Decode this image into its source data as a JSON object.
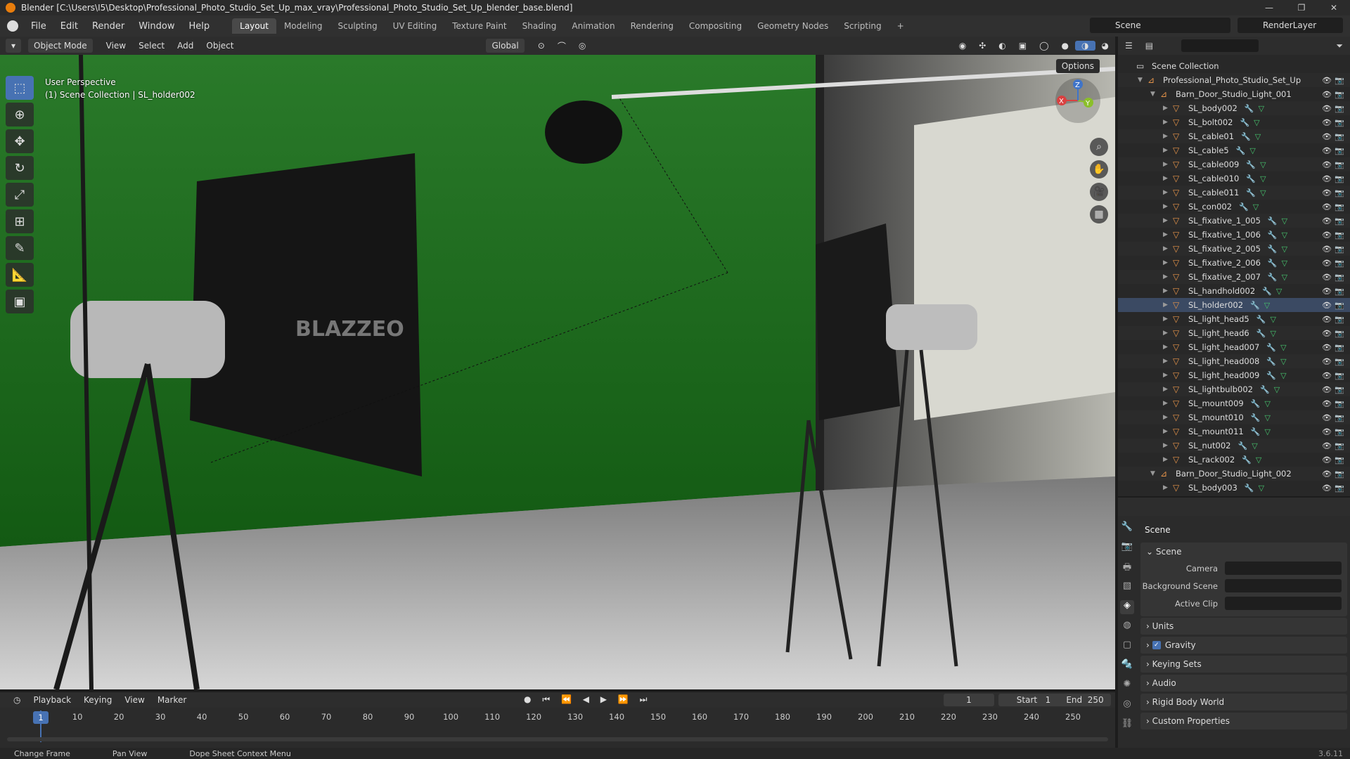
{
  "window": {
    "title": "Blender [C:\\Users\\I5\\Desktop\\Professional_Photo_Studio_Set_Up_max_vray\\Professional_Photo_Studio_Set_Up_blender_base.blend]",
    "controls": [
      "—",
      "❐",
      "✕"
    ]
  },
  "menu": [
    "File",
    "Edit",
    "Render",
    "Window",
    "Help"
  ],
  "workspaces": [
    "Layout",
    "Modeling",
    "Sculpting",
    "UV Editing",
    "Texture Paint",
    "Shading",
    "Animation",
    "Rendering",
    "Compositing",
    "Geometry Nodes",
    "Scripting",
    "+"
  ],
  "active_workspace": "Layout",
  "scene_selector": "Scene",
  "render_layer": "RenderLayer",
  "viewport_header": {
    "mode": "Object Mode",
    "menus": [
      "View",
      "Select",
      "Add",
      "Object"
    ],
    "transform_orientation": "Global",
    "options": "Options"
  },
  "viewport": {
    "perspective": "User Perspective",
    "context": "(1) Scene Collection | SL_holder002",
    "gizmo_axes": [
      "X",
      "Y",
      "Z"
    ]
  },
  "outliner": {
    "root": "Scene Collection",
    "rows": [
      {
        "label": "Professional_Photo_Studio_Set_Up",
        "depth": 1,
        "type": "collection"
      },
      {
        "label": "Barn_Door_Studio_Light_001",
        "depth": 2,
        "type": "collection"
      },
      {
        "label": "SL_body002",
        "depth": 3,
        "type": "mesh"
      },
      {
        "label": "SL_bolt002",
        "depth": 3,
        "type": "mesh"
      },
      {
        "label": "SL_cable01",
        "depth": 3,
        "type": "mesh"
      },
      {
        "label": "SL_cable5",
        "depth": 3,
        "type": "mesh"
      },
      {
        "label": "SL_cable009",
        "depth": 3,
        "type": "mesh"
      },
      {
        "label": "SL_cable010",
        "depth": 3,
        "type": "mesh"
      },
      {
        "label": "SL_cable011",
        "depth": 3,
        "type": "mesh"
      },
      {
        "label": "SL_con002",
        "depth": 3,
        "type": "mesh"
      },
      {
        "label": "SL_fixative_1_005",
        "depth": 3,
        "type": "mesh"
      },
      {
        "label": "SL_fixative_1_006",
        "depth": 3,
        "type": "mesh"
      },
      {
        "label": "SL_fixative_2_005",
        "depth": 3,
        "type": "mesh"
      },
      {
        "label": "SL_fixative_2_006",
        "depth": 3,
        "type": "mesh"
      },
      {
        "label": "SL_fixative_2_007",
        "depth": 3,
        "type": "mesh"
      },
      {
        "label": "SL_handhold002",
        "depth": 3,
        "type": "mesh"
      },
      {
        "label": "SL_holder002",
        "depth": 3,
        "type": "mesh",
        "selected": true
      },
      {
        "label": "SL_light_head5",
        "depth": 3,
        "type": "mesh"
      },
      {
        "label": "SL_light_head6",
        "depth": 3,
        "type": "mesh"
      },
      {
        "label": "SL_light_head007",
        "depth": 3,
        "type": "mesh"
      },
      {
        "label": "SL_light_head008",
        "depth": 3,
        "type": "mesh"
      },
      {
        "label": "SL_light_head009",
        "depth": 3,
        "type": "mesh"
      },
      {
        "label": "SL_lightbulb002",
        "depth": 3,
        "type": "mesh"
      },
      {
        "label": "SL_mount009",
        "depth": 3,
        "type": "mesh"
      },
      {
        "label": "SL_mount010",
        "depth": 3,
        "type": "mesh"
      },
      {
        "label": "SL_mount011",
        "depth": 3,
        "type": "mesh"
      },
      {
        "label": "SL_nut002",
        "depth": 3,
        "type": "mesh"
      },
      {
        "label": "SL_rack002",
        "depth": 3,
        "type": "mesh"
      },
      {
        "label": "Barn_Door_Studio_Light_002",
        "depth": 2,
        "type": "collection"
      },
      {
        "label": "SL_body003",
        "depth": 3,
        "type": "mesh"
      }
    ]
  },
  "properties": {
    "title": "Scene",
    "panel": "Scene",
    "fields": [
      {
        "label": "Camera"
      },
      {
        "label": "Background Scene"
      },
      {
        "label": "Active Clip"
      }
    ],
    "subpanels": [
      "Units",
      "Gravity",
      "Keying Sets",
      "Audio",
      "Rigid Body World",
      "Custom Properties"
    ],
    "gravity_checked": true
  },
  "timeline": {
    "menus": [
      "Playback",
      "Keying",
      "View",
      "Marker"
    ],
    "current_frame": "1",
    "start_label": "Start",
    "start": "1",
    "end_label": "End",
    "end": "250",
    "ticks": [
      "10",
      "20",
      "30",
      "40",
      "50",
      "60",
      "70",
      "80",
      "90",
      "100",
      "110",
      "120",
      "130",
      "140",
      "150",
      "160",
      "170",
      "180",
      "190",
      "200",
      "210",
      "220",
      "230",
      "240",
      "250"
    ],
    "playhead": "1"
  },
  "statusbar": {
    "items": [
      "Change Frame",
      "Pan View",
      "Dope Sheet Context Menu"
    ],
    "version": "3.6.11"
  },
  "colors": {
    "accent": "#4772b3",
    "green_screen": "#1f6a1f"
  }
}
